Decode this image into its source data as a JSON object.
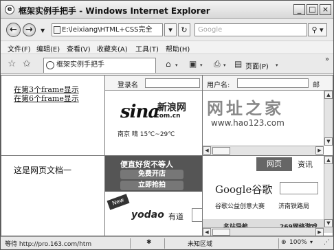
{
  "window": {
    "title": "框架实例手把手 - Windows Internet Explorer",
    "controls": {
      "minimize": "_",
      "maximize": "□",
      "close": "×"
    }
  },
  "address_bar": {
    "back_icon": "back-arrow-icon",
    "forward_icon": "forward-arrow-icon",
    "url": "E:\\leixiang\\HTML+CSS完全",
    "search_placeholder": "Google"
  },
  "menu": [
    "文件(F)",
    "编辑(E)",
    "查看(V)",
    "收藏夹(A)",
    "工具(T)",
    "帮助(H)"
  ],
  "tab": {
    "title": "框架实例手把手",
    "page_menu": "页面(P)"
  },
  "frames": {
    "nav": {
      "links": [
        "在第3个frame显示",
        "在第6个frame显示"
      ]
    },
    "doc": {
      "text": "这是网页文档一"
    },
    "sina": {
      "login_label": "登录名",
      "logo": "sina",
      "cn_name": "新浪网",
      "domain": ".com.cn",
      "weather": "南京 晴 15℃~29℃"
    },
    "ad": {
      "headline": "便直好货不等人",
      "button1": "免费开店",
      "button2": "立即抢拍",
      "brand": "yodao",
      "brand_cn": "有道",
      "corner": "New"
    },
    "hao123": {
      "user_label": "用户名:",
      "user_extra": "邮",
      "title": "网址之家",
      "url": "www.hao123.com"
    },
    "google": {
      "tab_web": "网页",
      "tab_info": "资讯",
      "logo": "Google谷歌",
      "sub_left": "谷歌公益创意大赛",
      "sub_right": "济南铁路局",
      "bottom_left": "名站导航",
      "bottom_right": "269网络游戏"
    }
  },
  "status": {
    "text": "等待 http://pro.163.com/htm",
    "zone": "未知区域",
    "zoom": "100%"
  }
}
